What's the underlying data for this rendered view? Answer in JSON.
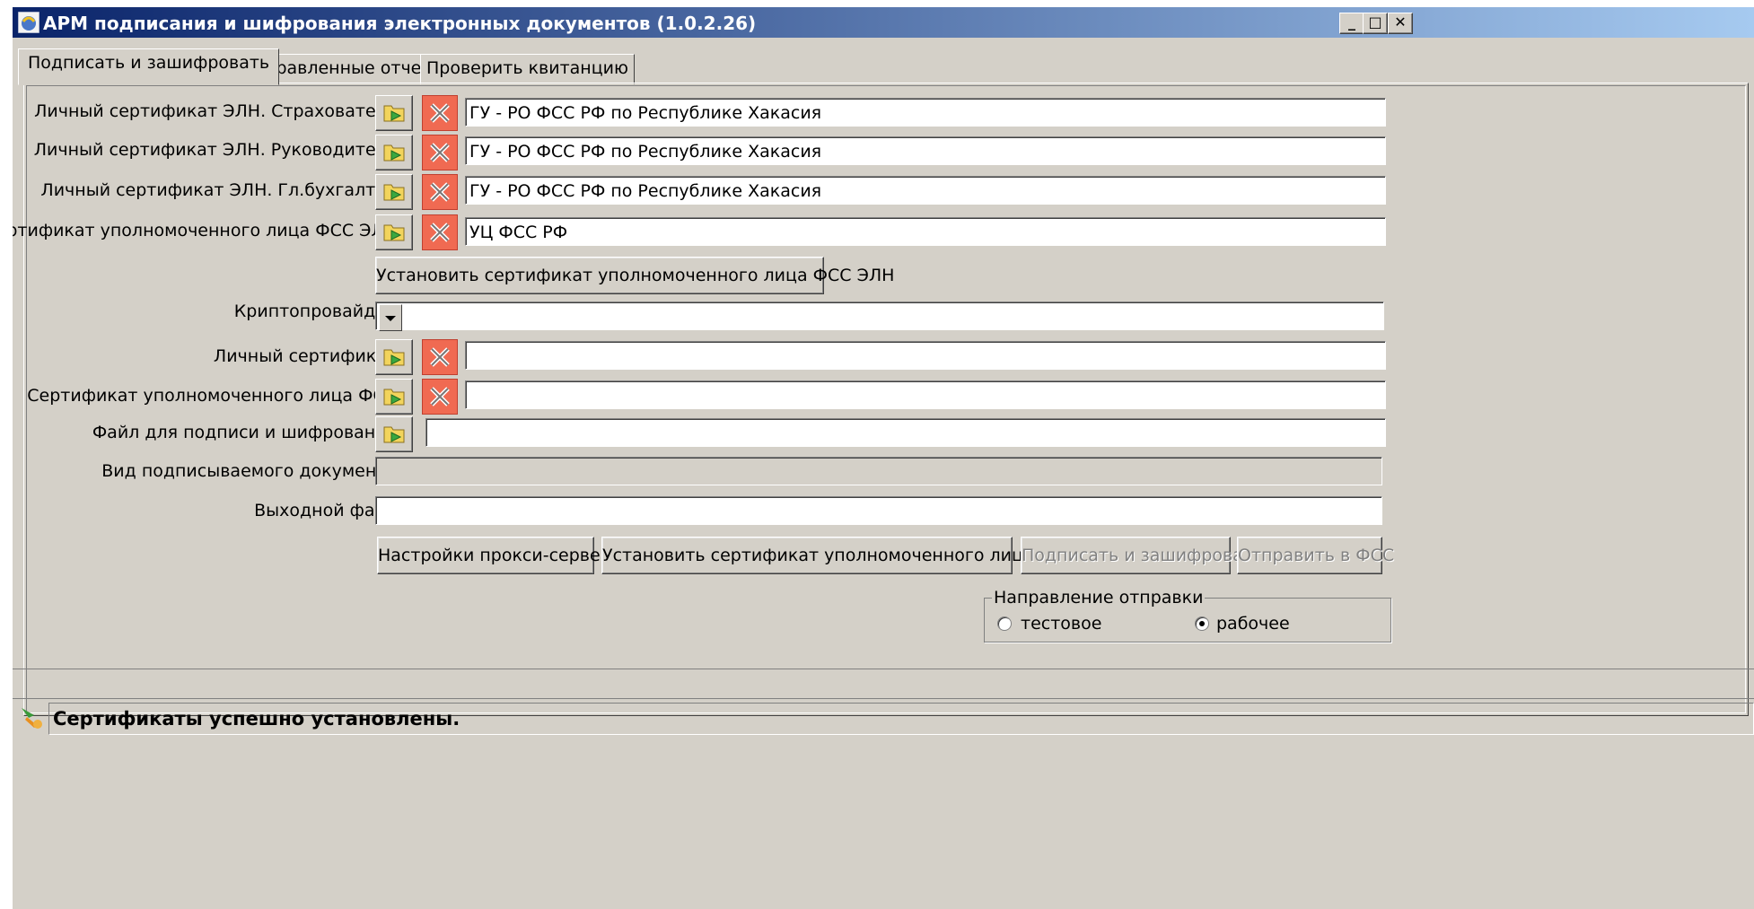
{
  "window": {
    "title": "АРМ подписания и шифрования электронных документов (1.0.2.26)",
    "minimize_label": "_",
    "maximize_label": "□",
    "close_label": "✕"
  },
  "tabs": [
    {
      "label": "Подписать и зашифровать",
      "active": true
    },
    {
      "label": "Отправленные отчеты",
      "active": false
    },
    {
      "label": "Проверить квитанцию",
      "active": false
    }
  ],
  "form": {
    "cert_insurer": {
      "label": "Личный сертификат ЭЛН. Страхователь",
      "value": "ГУ - РО ФСС РФ по Республике Хакасия"
    },
    "cert_director": {
      "label": "Личный сертификат ЭЛН. Руководитель",
      "value": "ГУ - РО ФСС РФ по Республике Хакасия"
    },
    "cert_accountant": {
      "label": "Личный сертификат ЭЛН. Гл.бухгалтер",
      "value": "ГУ - РО ФСС РФ по Республике Хакасия"
    },
    "cert_fss_eln": {
      "label": "Сертификат уполномоченного лица ФСС ЭЛН",
      "value": "УЦ ФСС РФ"
    },
    "install_fss_eln_button": "Установить сертификат уполномоченного лица ФСС ЭЛН",
    "crypto_provider": {
      "label": "Криптопровайдер",
      "value": ""
    },
    "personal_cert": {
      "label": "Личный сертификат",
      "value": ""
    },
    "cert_fss": {
      "label": "Сертификат уполномоченного лица ФСС",
      "value": ""
    },
    "file_to_sign": {
      "label": "Файл для подписи и шифрования",
      "value": ""
    },
    "document_type": {
      "label": "Вид подписываемого документа",
      "value": ""
    },
    "output_file": {
      "label": "Выходной файл",
      "value": ""
    }
  },
  "actions": {
    "proxy_settings": "Настройки прокси-сервера",
    "install_fss_cert": "Установить сертификат уполномоченного лица ФСС",
    "sign_encrypt": "Подписать и зашифровать",
    "send_to_fss": "Отправить в ФСС"
  },
  "direction": {
    "title": "Направление отправки",
    "options": [
      {
        "label": "тестовое",
        "selected": false
      },
      {
        "label": "рабочее",
        "selected": true
      }
    ]
  },
  "status": {
    "message": "Сертификаты успешно установлены."
  },
  "icons": {
    "open": "folder-open-icon",
    "clear": "clear-x-icon",
    "app": "app-icon",
    "status": "status-icon"
  }
}
